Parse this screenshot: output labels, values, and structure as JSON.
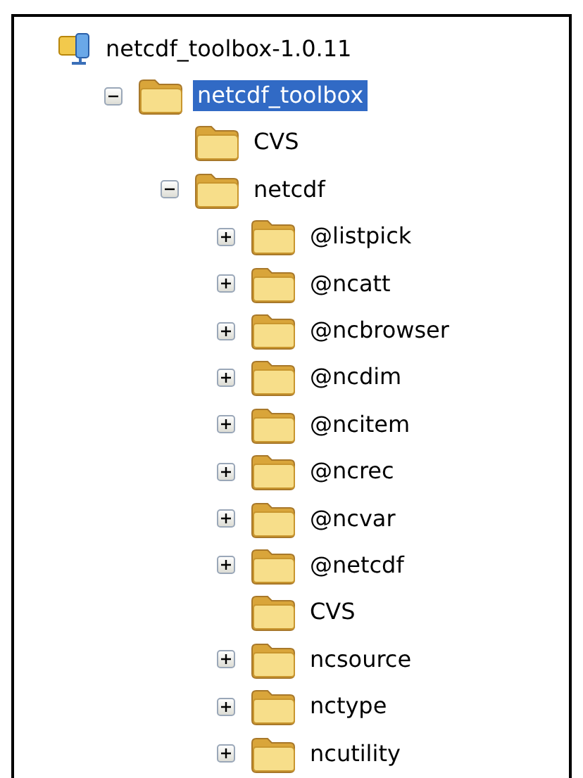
{
  "tree": {
    "label": "netcdf_toolbox-1.0.11",
    "kind": "drive",
    "selected": false,
    "children": [
      {
        "label": "netcdf_toolbox",
        "kind": "folder",
        "selected": true,
        "expanded": true,
        "children": [
          {
            "label": "CVS",
            "kind": "folder",
            "selected": false
          },
          {
            "label": "netcdf",
            "kind": "folder",
            "selected": false,
            "expanded": true,
            "children": [
              {
                "label": "@listpick",
                "kind": "folder",
                "selected": false,
                "expanded": false
              },
              {
                "label": "@ncatt",
                "kind": "folder",
                "selected": false,
                "expanded": false
              },
              {
                "label": "@ncbrowser",
                "kind": "folder",
                "selected": false,
                "expanded": false
              },
              {
                "label": "@ncdim",
                "kind": "folder",
                "selected": false,
                "expanded": false
              },
              {
                "label": "@ncitem",
                "kind": "folder",
                "selected": false,
                "expanded": false
              },
              {
                "label": "@ncrec",
                "kind": "folder",
                "selected": false,
                "expanded": false
              },
              {
                "label": "@ncvar",
                "kind": "folder",
                "selected": false,
                "expanded": false
              },
              {
                "label": "@netcdf",
                "kind": "folder",
                "selected": false,
                "expanded": false
              },
              {
                "label": "CVS",
                "kind": "folder",
                "selected": false
              },
              {
                "label": "ncsource",
                "kind": "folder",
                "selected": false,
                "expanded": false
              },
              {
                "label": "nctype",
                "kind": "folder",
                "selected": false,
                "expanded": false
              },
              {
                "label": "ncutility",
                "kind": "folder",
                "selected": false,
                "expanded": false
              }
            ]
          }
        ]
      }
    ]
  }
}
